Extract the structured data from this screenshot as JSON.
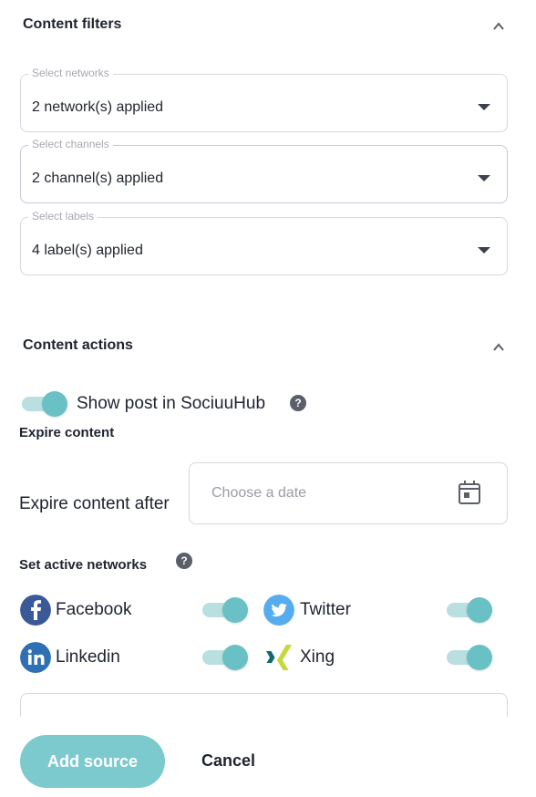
{
  "content_filters": {
    "title": "Content filters",
    "networks": {
      "legend": "Select networks",
      "value": "2 network(s) applied"
    },
    "channels": {
      "legend": "Select channels",
      "value": "2 channel(s) applied"
    },
    "labels": {
      "legend": "Select labels",
      "value": "4 label(s) applied"
    }
  },
  "content_actions": {
    "title": "Content actions",
    "show_post": {
      "label": "Show post in SociuuHub",
      "enabled": true
    },
    "expire": {
      "heading": "Expire content",
      "field_label": "Expire content after",
      "date_placeholder": "Choose a date"
    },
    "active_networks": {
      "heading": "Set active networks",
      "networks": [
        {
          "name": "Facebook",
          "icon": "facebook-icon",
          "enabled": true
        },
        {
          "name": "Twitter",
          "icon": "twitter-icon",
          "enabled": true
        },
        {
          "name": "Linkedin",
          "icon": "linkedin-icon",
          "enabled": true
        },
        {
          "name": "Xing",
          "icon": "xing-icon",
          "enabled": true
        }
      ]
    }
  },
  "footer": {
    "add_source_label": "Add source",
    "cancel_label": "Cancel"
  },
  "colors": {
    "accent": "#69c1c6",
    "accent_light": "#b9dfe1",
    "button": "#7ccace",
    "facebook": "#3b5998",
    "twitter": "#55acee",
    "linkedin": "#2f6fb3",
    "xing": "#0f6a6e"
  }
}
